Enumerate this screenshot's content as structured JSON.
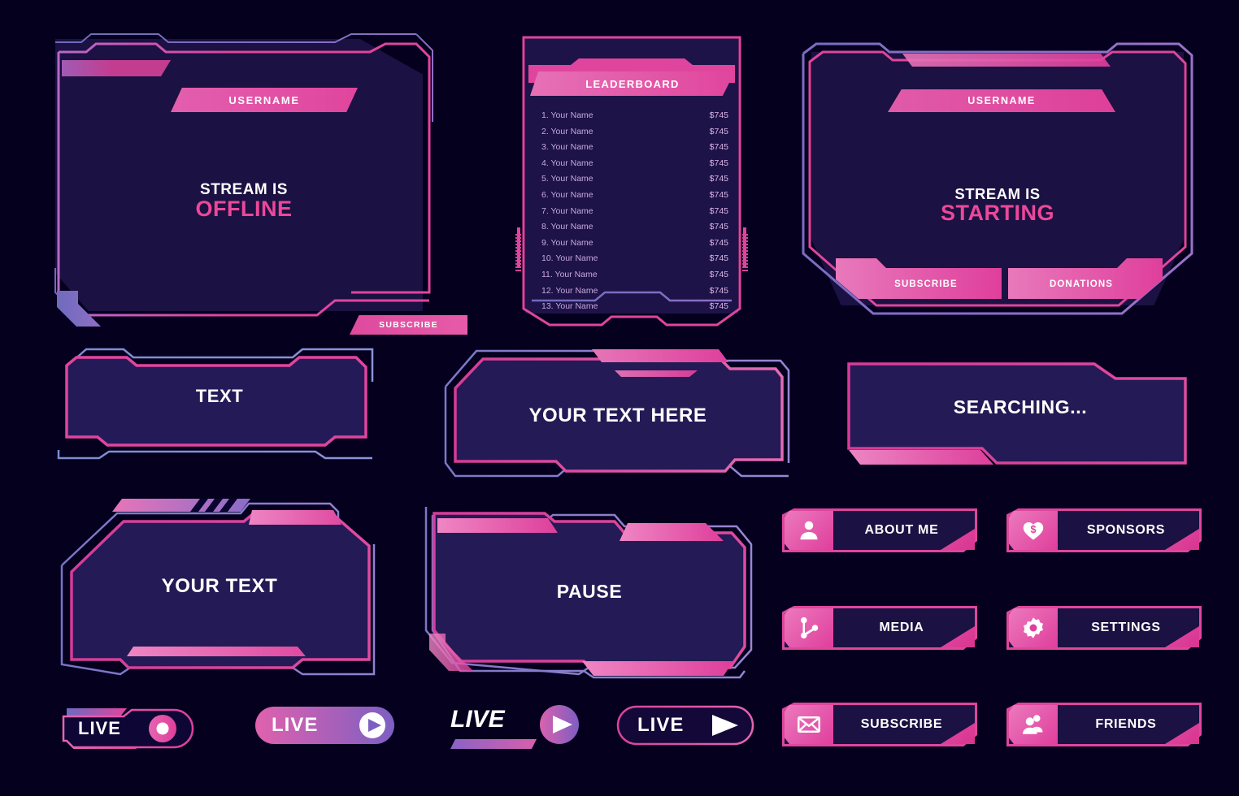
{
  "theme": {
    "background": "#04001e",
    "panel_fill": "#1b1142",
    "accent_pink": "#e0459e",
    "accent_pink_light": "#ec79bd",
    "accent_purple": "#7b6bc4",
    "text_white": "#ffffff",
    "text_muted": "#c6a7dd"
  },
  "offline_panel": {
    "name": "stream-offline-overlay",
    "username_label": "USERNAME",
    "status_line1": "STREAM IS",
    "status_line2": "OFFLINE",
    "subscribe_label": "SUBSCRIBE"
  },
  "leaderboard_panel": {
    "title": "LEADERBOARD",
    "rows": [
      {
        "rank": "1.",
        "name": "Your Name",
        "amount": "$745"
      },
      {
        "rank": "2.",
        "name": "Your Name",
        "amount": "$745"
      },
      {
        "rank": "3.",
        "name": "Your Name",
        "amount": "$745"
      },
      {
        "rank": "4.",
        "name": "Your Name",
        "amount": "$745"
      },
      {
        "rank": "5.",
        "name": "Your Name",
        "amount": "$745"
      },
      {
        "rank": "6.",
        "name": "Your Name",
        "amount": "$745"
      },
      {
        "rank": "7.",
        "name": "Your Name",
        "amount": "$745"
      },
      {
        "rank": "8.",
        "name": "Your Name",
        "amount": "$745"
      },
      {
        "rank": "9.",
        "name": "Your Name",
        "amount": "$745"
      },
      {
        "rank": "10.",
        "name": "Your Name",
        "amount": "$745"
      },
      {
        "rank": "11.",
        "name": "Your Name",
        "amount": "$745"
      },
      {
        "rank": "12.",
        "name": "Your Name",
        "amount": "$745"
      },
      {
        "rank": "13.",
        "name": "Your Name",
        "amount": "$745"
      }
    ]
  },
  "starting_panel": {
    "name": "stream-starting-overlay",
    "username_label": "USERNAME",
    "status_line1": "STREAM IS",
    "status_line2": "STARTING",
    "subscribe_label": "SUBSCRIBE",
    "donations_label": "DONATIONS"
  },
  "frames": [
    {
      "id": "text",
      "label": "TEXT"
    },
    {
      "id": "your-text-here",
      "label": "YOUR TEXT HERE"
    },
    {
      "id": "searching",
      "label": "SEARCHING..."
    },
    {
      "id": "your-text",
      "label": "YOUR TEXT"
    },
    {
      "id": "pause",
      "label": "PAUSE"
    }
  ],
  "menu_buttons": [
    {
      "id": "about-me",
      "label": "ABOUT ME",
      "icon": "person-icon"
    },
    {
      "id": "sponsors",
      "label": "SPONSORS",
      "icon": "heart-dollar-icon"
    },
    {
      "id": "media",
      "label": "MEDIA",
      "icon": "share-nodes-icon"
    },
    {
      "id": "settings",
      "label": "SETTINGS",
      "icon": "gear-icon"
    },
    {
      "id": "subscribe",
      "label": "SUBSCRIBE",
      "icon": "envelope-icon"
    },
    {
      "id": "friends",
      "label": "FRIENDS",
      "icon": "people-icon"
    }
  ],
  "live_badges": [
    {
      "id": "live-outline-dot",
      "label": "LIVE",
      "icon": "record-dot-icon"
    },
    {
      "id": "live-pill-play",
      "label": "LIVE",
      "icon": "play-circle-icon"
    },
    {
      "id": "live-italic-play",
      "label": "LIVE",
      "icon": "play-circle-icon"
    },
    {
      "id": "live-outline-play",
      "label": "LIVE",
      "icon": "play-triangle-icon"
    }
  ]
}
